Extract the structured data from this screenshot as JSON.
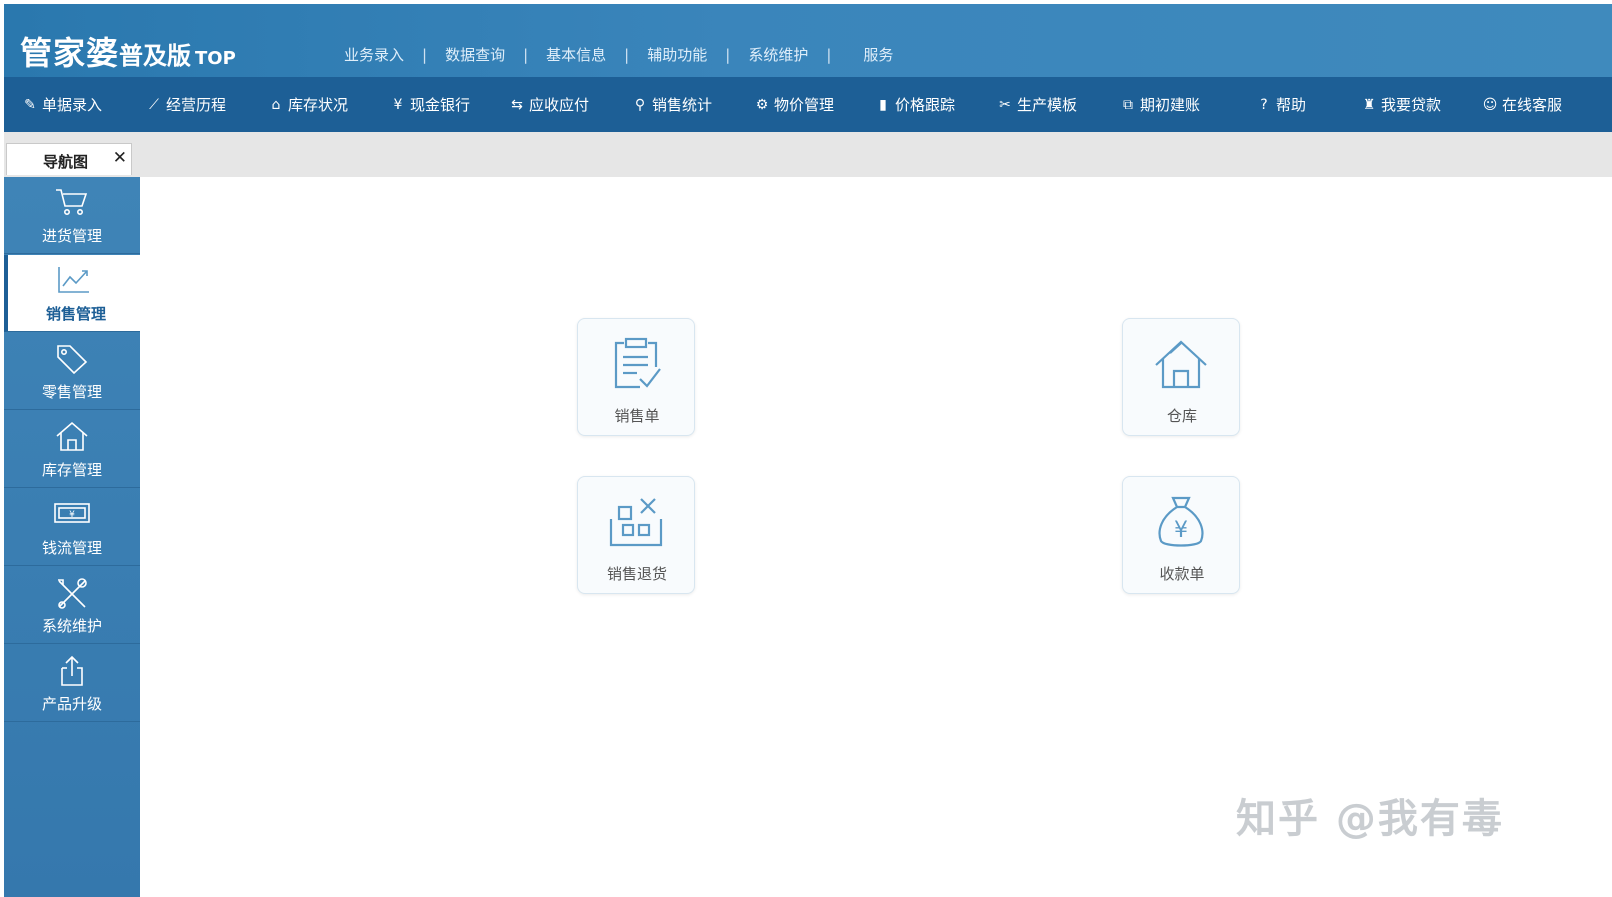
{
  "app": {
    "logo_main": "管家婆",
    "logo_sub": "普及版",
    "logo_top": "TOP"
  },
  "top_menu": [
    "业务录入",
    "数据查询",
    "基本信息",
    "辅助功能",
    "系统维护",
    "服务"
  ],
  "toolbar": [
    {
      "label": "单据录入",
      "icon": "document-edit-icon",
      "glyph": "✎"
    },
    {
      "label": "经营历程",
      "icon": "line-chart-icon",
      "glyph": "⟋"
    },
    {
      "label": "库存状况",
      "icon": "home-icon",
      "glyph": "⌂"
    },
    {
      "label": "现金银行",
      "icon": "yen-icon",
      "glyph": "¥"
    },
    {
      "label": "应收应付",
      "icon": "exchange-arrows-icon",
      "glyph": "⇆"
    },
    {
      "label": "销售统计",
      "icon": "search-icon",
      "glyph": "⚲"
    },
    {
      "label": "物价管理",
      "icon": "gear-icon",
      "glyph": "⚙"
    },
    {
      "label": "价格跟踪",
      "icon": "bar-chart-icon",
      "glyph": "▮"
    },
    {
      "label": "生产模板",
      "icon": "wrench-icon",
      "glyph": "✂"
    },
    {
      "label": "期初建账",
      "icon": "external-link-icon",
      "glyph": "⧉"
    },
    {
      "label": "帮助",
      "icon": "question-icon",
      "glyph": "?"
    },
    {
      "label": "我要贷款",
      "icon": "money-bag-icon",
      "glyph": "♜"
    },
    {
      "label": "在线客服",
      "icon": "chat-icon",
      "glyph": "☺"
    }
  ],
  "tab": {
    "label": "导航图",
    "close": "✕"
  },
  "sidebar": [
    {
      "label": "进货管理",
      "icon": "cart-icon"
    },
    {
      "label": "销售管理",
      "icon": "trend-chart-icon",
      "active": true
    },
    {
      "label": "零售管理",
      "icon": "tag-icon"
    },
    {
      "label": "库存管理",
      "icon": "house-icon"
    },
    {
      "label": "钱流管理",
      "icon": "banknote-icon"
    },
    {
      "label": "系统维护",
      "icon": "tools-icon"
    },
    {
      "label": "产品升级",
      "icon": "upload-icon"
    }
  ],
  "tiles": [
    {
      "label": "销售单",
      "icon": "clipboard-check-icon"
    },
    {
      "label": "仓库",
      "icon": "warehouse-icon"
    },
    {
      "label": "销售退货",
      "icon": "boxes-return-icon"
    },
    {
      "label": "收款单",
      "icon": "yen-bag-icon"
    }
  ],
  "watermark": "知乎 @我有毒",
  "colors": {
    "header": "#2a78ae",
    "toolbar": "#1d5f96",
    "sidebar": "#3f84b7",
    "icon": "#5b9ac6"
  }
}
